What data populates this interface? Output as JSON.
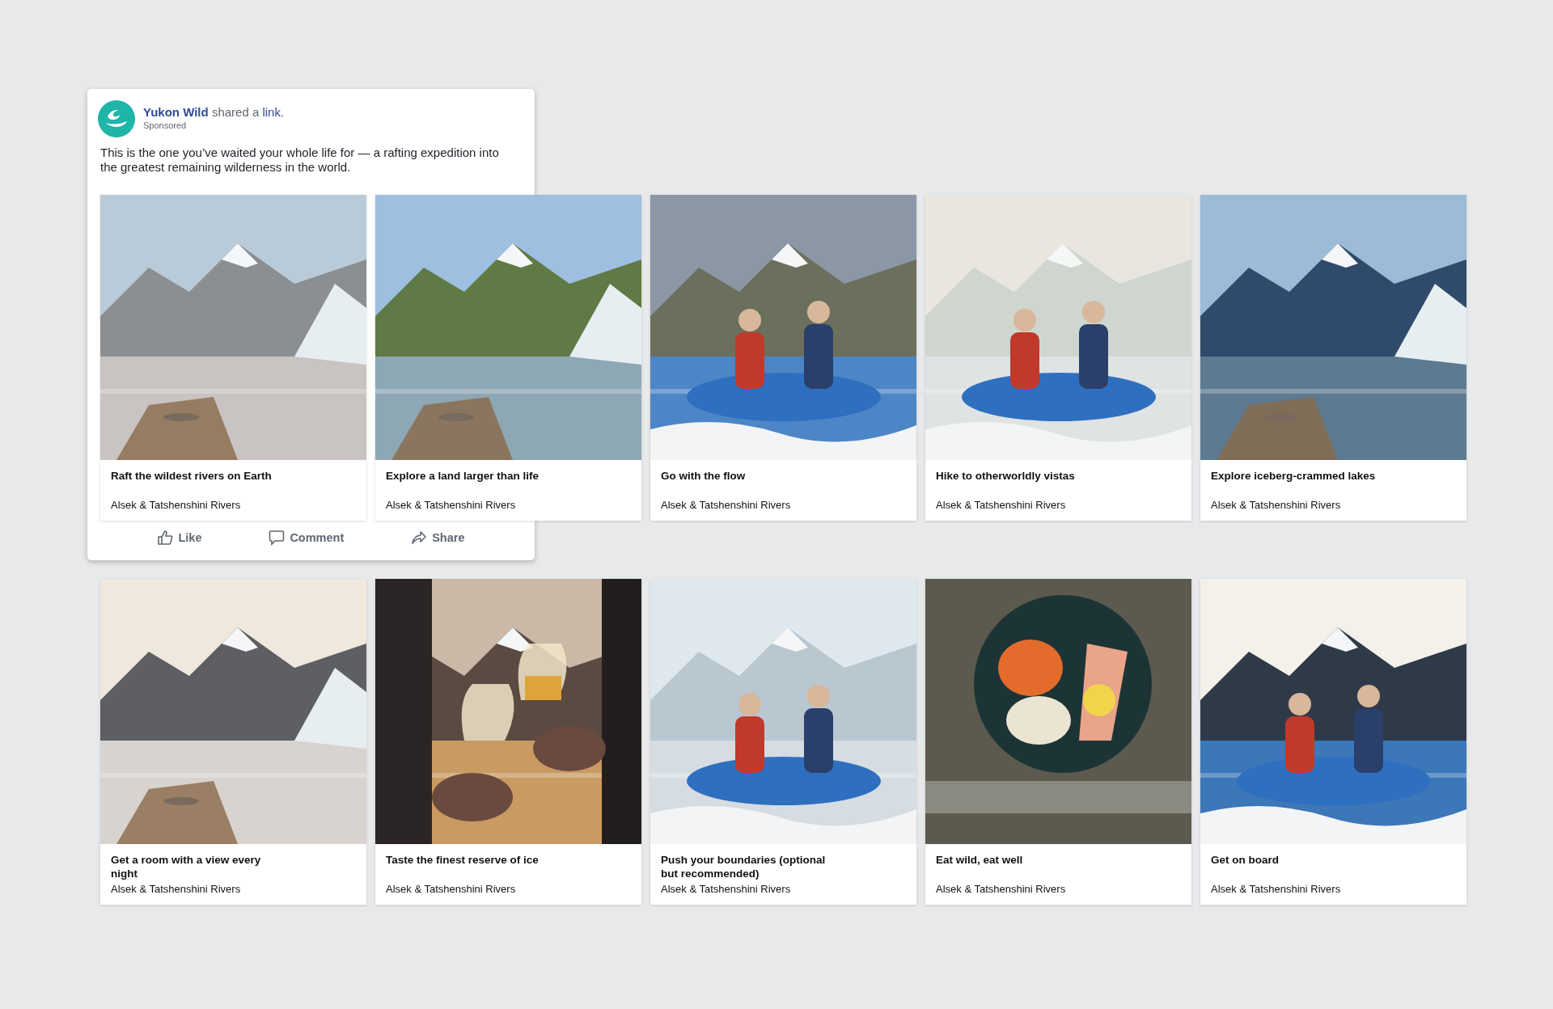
{
  "post": {
    "page_name": "Yukon Wild",
    "action": "shared a",
    "link_text": "link.",
    "sponsored": "Sponsored",
    "message": "This is the one you’ve waited your whole life for — a rafting expedition into the greatest remaining wilderness in the world.",
    "actions": [
      {
        "kind": "like",
        "label": "Like"
      },
      {
        "kind": "comment",
        "label": "Comment"
      },
      {
        "kind": "share",
        "label": "Share"
      }
    ]
  },
  "cards": [
    {
      "title": "Raft the wildest rivers on Earth",
      "subtitle": "Alsek & Tatshenshini Rivers"
    },
    {
      "title": "Explore a land larger than life",
      "subtitle": "Alsek & Tatshenshini Rivers"
    },
    {
      "title": "Go with the flow",
      "subtitle": "Alsek & Tatshenshini Rivers"
    },
    {
      "title": "Hike to otherworldly vistas",
      "subtitle": "Alsek & Tatshenshini Rivers"
    },
    {
      "title": "Explore iceberg-crammed lakes",
      "subtitle": "Alsek & Tatshenshini Rivers"
    },
    {
      "title": "Get a room with a view every night",
      "subtitle": "Alsek & Tatshenshini Rivers"
    },
    {
      "title": "Taste the finest reserve of ice",
      "subtitle": "Alsek & Tatshenshini Rivers",
      "kind": "picture"
    },
    {
      "title": "Push your boundaries (optional but recommended)",
      "subtitle": "Alsek & Tatshenshini Rivers"
    },
    {
      "title": "Eat wild, eat well",
      "subtitle": "Alsek & Tatshenshini Rivers"
    },
    {
      "title": "Get on board",
      "subtitle": "Alsek & Tatshenshini Rivers"
    }
  ]
}
